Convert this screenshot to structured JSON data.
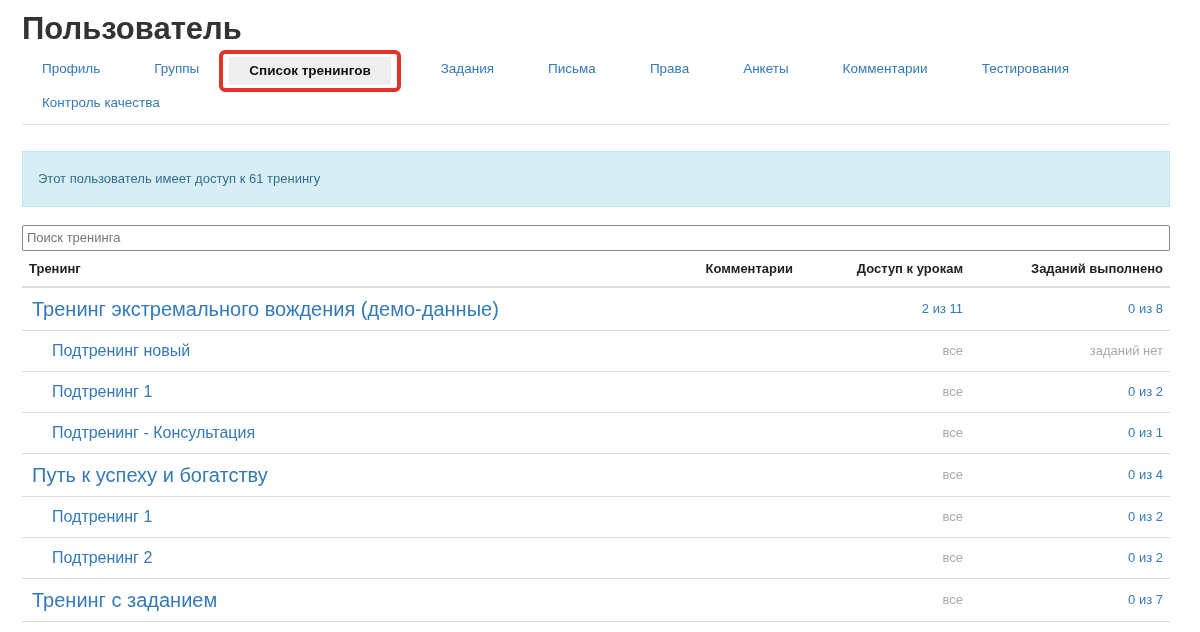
{
  "title": "Пользователь",
  "tabs": [
    {
      "label": "Профиль",
      "selected": false,
      "highlighted": false
    },
    {
      "label": "Группы",
      "selected": false,
      "highlighted": false
    },
    {
      "label": "Список тренингов",
      "selected": true,
      "highlighted": true
    },
    {
      "label": "Задания",
      "selected": false,
      "highlighted": false
    },
    {
      "label": "Письма",
      "selected": false,
      "highlighted": false
    },
    {
      "label": "Права",
      "selected": false,
      "highlighted": false
    },
    {
      "label": "Анкеты",
      "selected": false,
      "highlighted": false
    },
    {
      "label": "Комментарии",
      "selected": false,
      "highlighted": false
    },
    {
      "label": "Тестирования",
      "selected": false,
      "highlighted": false
    },
    {
      "label": "Контроль качества",
      "selected": false,
      "highlighted": false
    }
  ],
  "alert": "Этот пользователь имеет доступ к 61 тренингу",
  "search": {
    "placeholder": "Поиск тренинга"
  },
  "table": {
    "columns": [
      "Тренинг",
      "Комментарии",
      "Доступ к урокам",
      "Заданий выполнено"
    ],
    "rows": [
      {
        "name": "Тренинг экстремального вождения (демо-данные)",
        "access": {
          "text": "2 из 11",
          "link": true
        },
        "tasks": {
          "text": "0 из 8",
          "link": true
        },
        "children": [
          {
            "name": "Подтренинг новый",
            "access": {
              "text": "все",
              "link": false
            },
            "tasks": {
              "text": "заданий нет",
              "link": false
            }
          },
          {
            "name": "Подтренинг 1",
            "access": {
              "text": "все",
              "link": false
            },
            "tasks": {
              "text": "0 из 2",
              "link": true
            }
          },
          {
            "name": "Подтренинг - Консультация",
            "access": {
              "text": "все",
              "link": false
            },
            "tasks": {
              "text": "0 из 1",
              "link": true
            }
          }
        ]
      },
      {
        "name": "Путь к успеху и богатству",
        "access": {
          "text": "все",
          "link": false
        },
        "tasks": {
          "text": "0 из 4",
          "link": true
        },
        "children": [
          {
            "name": "Подтренинг 1",
            "access": {
              "text": "все",
              "link": false
            },
            "tasks": {
              "text": "0 из 2",
              "link": true
            }
          },
          {
            "name": "Подтренинг 2",
            "access": {
              "text": "все",
              "link": false
            },
            "tasks": {
              "text": "0 из 2",
              "link": true
            }
          }
        ]
      },
      {
        "name": "Тренинг с заданием",
        "access": {
          "text": "все",
          "link": false
        },
        "tasks": {
          "text": "0 из 7",
          "link": true
        }
      }
    ]
  }
}
